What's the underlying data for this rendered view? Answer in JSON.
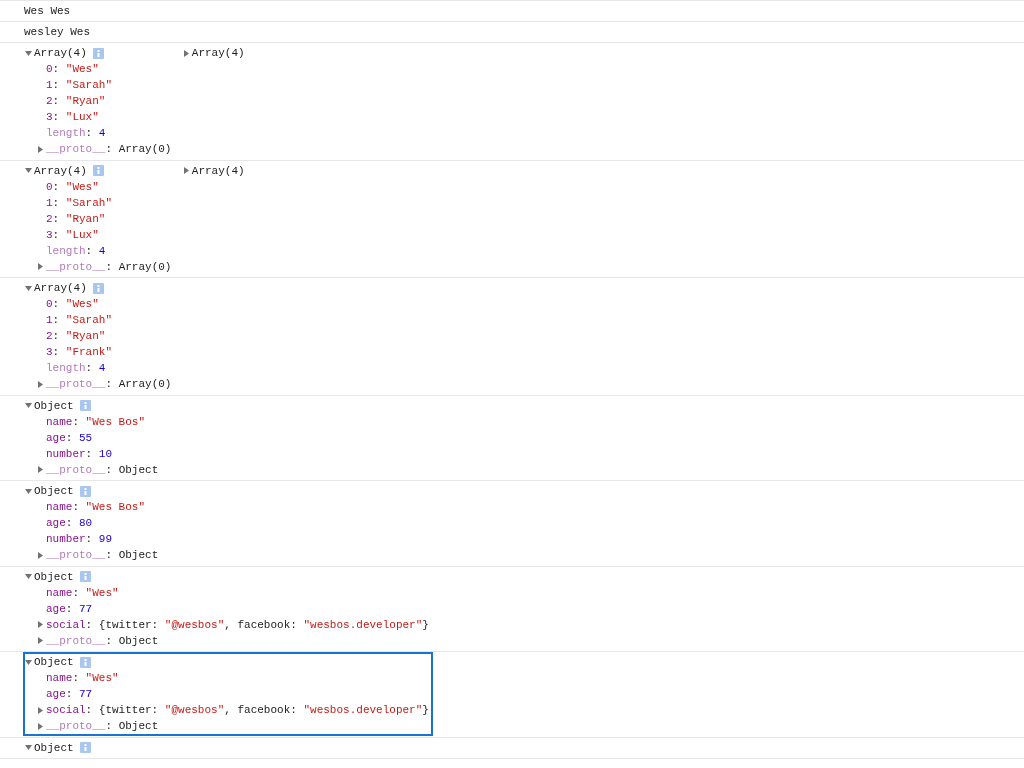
{
  "messages": [
    {
      "kind": "text",
      "text": "Wes Wes",
      "selected": false
    },
    {
      "kind": "text",
      "text": "wesley Wes",
      "selected": false
    },
    {
      "kind": "tree",
      "label": "Array(4)",
      "expanded": true,
      "preview": "Array(4)",
      "selected": false,
      "properties": [
        {
          "key": "0",
          "dim": false,
          "expandable": false,
          "value": [
            {
              "text": ": ",
              "kind": "plain"
            },
            {
              "text": "\"Wes\"",
              "kind": "string"
            }
          ]
        },
        {
          "key": "1",
          "dim": false,
          "expandable": false,
          "value": [
            {
              "text": ": ",
              "kind": "plain"
            },
            {
              "text": "\"Sarah\"",
              "kind": "string"
            }
          ]
        },
        {
          "key": "2",
          "dim": false,
          "expandable": false,
          "value": [
            {
              "text": ": ",
              "kind": "plain"
            },
            {
              "text": "\"Ryan\"",
              "kind": "string"
            }
          ]
        },
        {
          "key": "3",
          "dim": false,
          "expandable": false,
          "value": [
            {
              "text": ": ",
              "kind": "plain"
            },
            {
              "text": "\"Lux\"",
              "kind": "string"
            }
          ]
        },
        {
          "key": "length",
          "dim": true,
          "expandable": false,
          "value": [
            {
              "text": ": ",
              "kind": "plain"
            },
            {
              "text": "4",
              "kind": "number"
            }
          ]
        },
        {
          "key": "__proto__",
          "dim": true,
          "expandable": true,
          "value": [
            {
              "text": ": ",
              "kind": "plain"
            },
            {
              "text": "Array(0)",
              "kind": "plain"
            }
          ]
        }
      ]
    },
    {
      "kind": "tree",
      "label": "Array(4)",
      "expanded": true,
      "preview": "Array(4)",
      "selected": false,
      "properties": [
        {
          "key": "0",
          "dim": false,
          "expandable": false,
          "value": [
            {
              "text": ": ",
              "kind": "plain"
            },
            {
              "text": "\"Wes\"",
              "kind": "string"
            }
          ]
        },
        {
          "key": "1",
          "dim": false,
          "expandable": false,
          "value": [
            {
              "text": ": ",
              "kind": "plain"
            },
            {
              "text": "\"Sarah\"",
              "kind": "string"
            }
          ]
        },
        {
          "key": "2",
          "dim": false,
          "expandable": false,
          "value": [
            {
              "text": ": ",
              "kind": "plain"
            },
            {
              "text": "\"Ryan\"",
              "kind": "string"
            }
          ]
        },
        {
          "key": "3",
          "dim": false,
          "expandable": false,
          "value": [
            {
              "text": ": ",
              "kind": "plain"
            },
            {
              "text": "\"Lux\"",
              "kind": "string"
            }
          ]
        },
        {
          "key": "length",
          "dim": true,
          "expandable": false,
          "value": [
            {
              "text": ": ",
              "kind": "plain"
            },
            {
              "text": "4",
              "kind": "number"
            }
          ]
        },
        {
          "key": "__proto__",
          "dim": true,
          "expandable": true,
          "value": [
            {
              "text": ": ",
              "kind": "plain"
            },
            {
              "text": "Array(0)",
              "kind": "plain"
            }
          ]
        }
      ]
    },
    {
      "kind": "tree",
      "label": "Array(4)",
      "expanded": true,
      "selected": false,
      "properties": [
        {
          "key": "0",
          "dim": false,
          "expandable": false,
          "value": [
            {
              "text": ": ",
              "kind": "plain"
            },
            {
              "text": "\"Wes\"",
              "kind": "string"
            }
          ]
        },
        {
          "key": "1",
          "dim": false,
          "expandable": false,
          "value": [
            {
              "text": ": ",
              "kind": "plain"
            },
            {
              "text": "\"Sarah\"",
              "kind": "string"
            }
          ]
        },
        {
          "key": "2",
          "dim": false,
          "expandable": false,
          "value": [
            {
              "text": ": ",
              "kind": "plain"
            },
            {
              "text": "\"Ryan\"",
              "kind": "string"
            }
          ]
        },
        {
          "key": "3",
          "dim": false,
          "expandable": false,
          "value": [
            {
              "text": ": ",
              "kind": "plain"
            },
            {
              "text": "\"Frank\"",
              "kind": "string"
            }
          ]
        },
        {
          "key": "length",
          "dim": true,
          "expandable": false,
          "value": [
            {
              "text": ": ",
              "kind": "plain"
            },
            {
              "text": "4",
              "kind": "number"
            }
          ]
        },
        {
          "key": "__proto__",
          "dim": true,
          "expandable": true,
          "value": [
            {
              "text": ": ",
              "kind": "plain"
            },
            {
              "text": "Array(0)",
              "kind": "plain"
            }
          ]
        }
      ]
    },
    {
      "kind": "tree",
      "label": "Object",
      "expanded": true,
      "selected": false,
      "properties": [
        {
          "key": "name",
          "dim": false,
          "expandable": false,
          "value": [
            {
              "text": ": ",
              "kind": "plain"
            },
            {
              "text": "\"Wes Bos\"",
              "kind": "string"
            }
          ]
        },
        {
          "key": "age",
          "dim": false,
          "expandable": false,
          "value": [
            {
              "text": ": ",
              "kind": "plain"
            },
            {
              "text": "55",
              "kind": "number"
            }
          ]
        },
        {
          "key": "number",
          "dim": false,
          "expandable": false,
          "value": [
            {
              "text": ": ",
              "kind": "plain"
            },
            {
              "text": "10",
              "kind": "number"
            }
          ]
        },
        {
          "key": "__proto__",
          "dim": true,
          "expandable": true,
          "value": [
            {
              "text": ": ",
              "kind": "plain"
            },
            {
              "text": "Object",
              "kind": "plain"
            }
          ]
        }
      ]
    },
    {
      "kind": "tree",
      "label": "Object",
      "expanded": true,
      "selected": false,
      "properties": [
        {
          "key": "name",
          "dim": false,
          "expandable": false,
          "value": [
            {
              "text": ": ",
              "kind": "plain"
            },
            {
              "text": "\"Wes Bos\"",
              "kind": "string"
            }
          ]
        },
        {
          "key": "age",
          "dim": false,
          "expandable": false,
          "value": [
            {
              "text": ": ",
              "kind": "plain"
            },
            {
              "text": "80",
              "kind": "number"
            }
          ]
        },
        {
          "key": "number",
          "dim": false,
          "expandable": false,
          "value": [
            {
              "text": ": ",
              "kind": "plain"
            },
            {
              "text": "99",
              "kind": "number"
            }
          ]
        },
        {
          "key": "__proto__",
          "dim": true,
          "expandable": true,
          "value": [
            {
              "text": ": ",
              "kind": "plain"
            },
            {
              "text": "Object",
              "kind": "plain"
            }
          ]
        }
      ]
    },
    {
      "kind": "tree",
      "label": "Object",
      "expanded": true,
      "selected": false,
      "properties": [
        {
          "key": "name",
          "dim": false,
          "expandable": false,
          "value": [
            {
              "text": ": ",
              "kind": "plain"
            },
            {
              "text": "\"Wes\"",
              "kind": "string"
            }
          ]
        },
        {
          "key": "age",
          "dim": false,
          "expandable": false,
          "value": [
            {
              "text": ": ",
              "kind": "plain"
            },
            {
              "text": "77",
              "kind": "number"
            }
          ]
        },
        {
          "key": "social",
          "dim": false,
          "expandable": true,
          "value": [
            {
              "text": ": {twitter: ",
              "kind": "plain"
            },
            {
              "text": "\"@wesbos\"",
              "kind": "string"
            },
            {
              "text": ", facebook: ",
              "kind": "plain"
            },
            {
              "text": "\"wesbos.developer\"",
              "kind": "string"
            },
            {
              "text": "}",
              "kind": "plain"
            }
          ]
        },
        {
          "key": "__proto__",
          "dim": true,
          "expandable": true,
          "value": [
            {
              "text": ": ",
              "kind": "plain"
            },
            {
              "text": "Object",
              "kind": "plain"
            }
          ]
        }
      ]
    },
    {
      "kind": "tree",
      "label": "Object",
      "expanded": true,
      "selected": true,
      "properties": [
        {
          "key": "name",
          "dim": false,
          "expandable": false,
          "value": [
            {
              "text": ": ",
              "kind": "plain"
            },
            {
              "text": "\"Wes\"",
              "kind": "string"
            }
          ]
        },
        {
          "key": "age",
          "dim": false,
          "expandable": false,
          "value": [
            {
              "text": ": ",
              "kind": "plain"
            },
            {
              "text": "77",
              "kind": "number"
            }
          ]
        },
        {
          "key": "social",
          "dim": false,
          "expandable": true,
          "value": [
            {
              "text": ": {twitter: ",
              "kind": "plain"
            },
            {
              "text": "\"@wesbos\"",
              "kind": "string"
            },
            {
              "text": ", facebook: ",
              "kind": "plain"
            },
            {
              "text": "\"wesbos.developer\"",
              "kind": "string"
            },
            {
              "text": "}",
              "kind": "plain"
            }
          ]
        },
        {
          "key": "__proto__",
          "dim": true,
          "expandable": true,
          "value": [
            {
              "text": ": ",
              "kind": "plain"
            },
            {
              "text": "Object",
              "kind": "plain"
            }
          ]
        }
      ]
    },
    {
      "kind": "tree",
      "label": "Object",
      "expanded": true,
      "selected": false
    }
  ]
}
